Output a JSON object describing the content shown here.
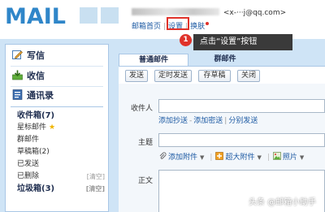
{
  "header": {
    "logo_text": "MAIL",
    "account_email": "<x-···j@qq.com>",
    "links": {
      "inbox_home": "邮箱首页",
      "settings": "设置",
      "skin": "换肤"
    }
  },
  "callout": {
    "badge": "1",
    "text": "点击“设置”按钮"
  },
  "sidebar": {
    "actions": [
      {
        "label": "写信",
        "icon": "pen-icon"
      },
      {
        "label": "收信",
        "icon": "inbox-arrow-icon"
      },
      {
        "label": "通讯录",
        "icon": "contacts-icon"
      }
    ],
    "folders": {
      "inbox": "收件箱(7)",
      "starred": "星标邮件",
      "group": "群邮件",
      "drafts": "草稿箱(2)",
      "sent": "已发送",
      "deleted": "已删除",
      "spam": "垃圾箱(3)",
      "clear": "[清空]"
    }
  },
  "compose": {
    "tabs": {
      "normal": "普通邮件",
      "group": "群邮件"
    },
    "toolbar": {
      "send": "发送",
      "scheduled_send": "定时发送",
      "save_draft": "存草稿",
      "close": "关闭"
    },
    "labels": {
      "recipient": "收件人",
      "subject": "主题",
      "body": "正文"
    },
    "recipient_links": {
      "add_cc": "添加抄送",
      "add_bcc": "添加密送",
      "separate_send": "分别发送"
    },
    "attach": {
      "add_attachment": "添加附件",
      "large_attachment": "超大附件",
      "photo": "照片"
    }
  },
  "watermark": "头条 @邮箱小助手",
  "colors": {
    "accent_red": "#e0322a",
    "link_blue": "#1d5aa3",
    "frame_blue": "#cfe4f6",
    "callout_bg": "#3a3a3a"
  }
}
